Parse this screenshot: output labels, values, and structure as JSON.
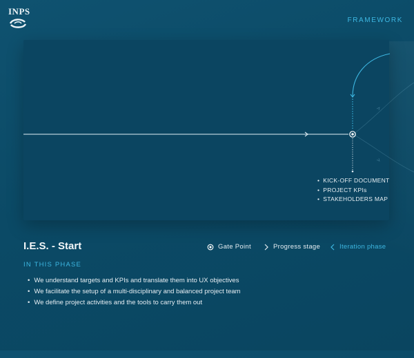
{
  "brand": {
    "logo_text": "INPS"
  },
  "header": {
    "framework_label": "FRAMEWORK"
  },
  "diagram": {
    "outputs": [
      "KICK-OFF DOCUMENT",
      "PROJECT KPIs",
      "STAKEHOLDERS MAP"
    ]
  },
  "phase": {
    "title": "I.E.S. - Start",
    "section_label": "IN THIS PHASE",
    "items": [
      "We understand targets and KPIs and translate them into UX objectives",
      "We facilitate the setup of a multi-disciplinary and balanced project team",
      "We define project activities and the tools to carry them out"
    ]
  },
  "legend": {
    "gate_point": "Gate Point",
    "progress_stage": "Progress stage",
    "iteration_phase": "Iteration phase"
  },
  "colors": {
    "accent": "#3db7e2",
    "background": "#0b4a66",
    "panel": "#0b4561"
  }
}
